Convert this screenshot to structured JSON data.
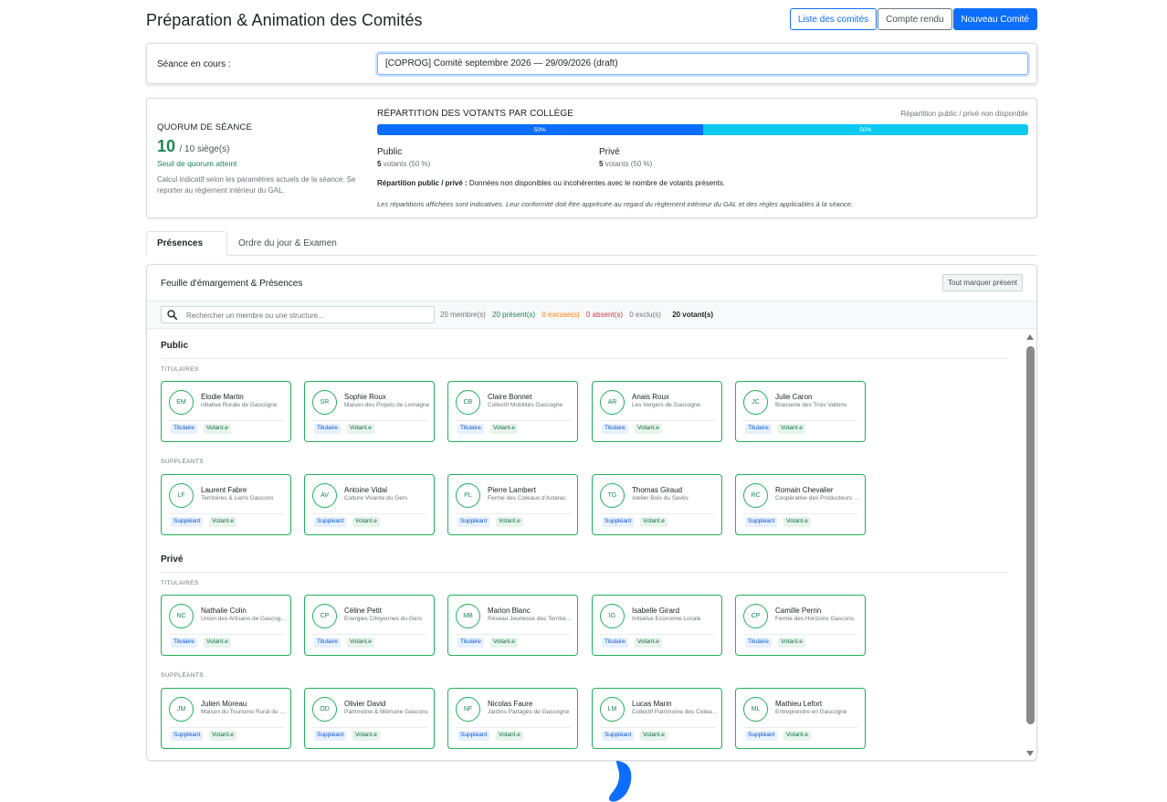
{
  "header": {
    "title": "Préparation & Animation des Comités",
    "btn_list": "Liste des comités",
    "btn_report": "Compte rendu",
    "btn_new": "Nouveau Comité"
  },
  "session": {
    "label": "Séance en cours :",
    "value": "[COPROG] Comité septembre 2026 — 29/09/2026 (draft)"
  },
  "quorum": {
    "title": "QUORUM DE SÉANCE",
    "count": "10",
    "seats": "/ 10 siège(s)",
    "status": "Seuil de quorum atteint",
    "note": "Calcul indicatif selon les paramètres actuels de la séance. Se reporter au règlement intérieur du GAL."
  },
  "split": {
    "title": "RÉPARTITION DES VOTANTS PAR COLLÈGE",
    "unavailable": "Répartition public / privé non disponible",
    "bar": [
      {
        "label": "50%",
        "fraction": 0.5,
        "color": "#0d6efd"
      },
      {
        "label": "50%",
        "fraction": 0.5,
        "color": "#0dcaf0"
      }
    ],
    "public": {
      "name": "Public",
      "votes_num": "5",
      "votes_text": "votants (50 %)"
    },
    "private": {
      "name": "Privé",
      "votes_num": "5",
      "votes_text": "votants (50 %)"
    },
    "split_label": "Répartition public / privé :",
    "split_text": "Données non disponibles ou incohérentes avec le nombre de votants présents.",
    "disclaimer": "Les répartitions affichées sont indicatives. Leur conformité doit être appréciée au regard du règlement intérieur du GAL et des règles applicables à la séance."
  },
  "tabs": [
    {
      "label": "Présences",
      "active": true
    },
    {
      "label": "Ordre du jour & Examen",
      "active": false
    }
  ],
  "attendance": {
    "title": "Feuille d'émargement & Présences",
    "mark_all": "Tout marquer présent",
    "search_placeholder": "Rechercher un membre ou une structure...",
    "stats": {
      "members": "20 membre(s)",
      "present": "20 présent(s)",
      "excused": "0 excuse(s)",
      "absent": "0 absent(s)",
      "excluded": "0 exclu(s)",
      "voting": "20 votant(s)"
    },
    "groups": [
      {
        "name": "Public",
        "sections": [
          {
            "label": "TITULAIRES",
            "role": "Titulaire",
            "members": [
              {
                "initials": "EM",
                "name": "Élodie Martin",
                "org": "nitiative Rurale de Gascogne",
                "vote": "Votant.e"
              },
              {
                "initials": "SR",
                "name": "Sophie Roux",
                "org": "Maison des Projets de Lomagne",
                "vote": "Votant.e"
              },
              {
                "initials": "CB",
                "name": "Claire Bonnet",
                "org": "Collectif Mobilités Gascogne",
                "vote": "Votant.e"
              },
              {
                "initials": "AR",
                "name": "Anais Roux",
                "org": "Les Vergers de Gascogne",
                "vote": "Votant.e"
              },
              {
                "initials": "JC",
                "name": "Julie Caron",
                "org": "Brasserie des Trois Vallons",
                "vote": "Votant.e"
              }
            ]
          },
          {
            "label": "SUPPLÉANTS",
            "role": "Suppléant",
            "members": [
              {
                "initials": "LF",
                "name": "Laurent Fabre",
                "org": "Territoires & Liens Gascons",
                "vote": "Votant.e"
              },
              {
                "initials": "AV",
                "name": "Antoine Vidal",
                "org": "Culture Vivante du Gers",
                "vote": "Votant.e"
              },
              {
                "initials": "PL",
                "name": "Pierre Lambert",
                "org": "Ferme des Coteaux d'Astarac",
                "vote": "Votant.e"
              },
              {
                "initials": "TG",
                "name": "Thomas Giraud",
                "org": "Atelier Bois du Savès",
                "vote": "Votant.e"
              },
              {
                "initials": "RC",
                "name": "Romain Chevalier",
                "org": "Coopérative des Producteurs du Gers",
                "vote": "Votant.e"
              }
            ]
          }
        ]
      },
      {
        "name": "Privé",
        "sections": [
          {
            "label": "TITULAIRES",
            "role": "Titulaire",
            "members": [
              {
                "initials": "NC",
                "name": "Nathalie Colin",
                "org": "Union des Artisans de Gascogne",
                "vote": "Votant.e"
              },
              {
                "initials": "CP",
                "name": "Céline Petit",
                "org": "Energies Citoyennes du Gers",
                "vote": "Votant.e"
              },
              {
                "initials": "MB",
                "name": "Marion Blanc",
                "org": "Réseau Jeunesse des Territoires",
                "vote": "Votant.e"
              },
              {
                "initials": "IG",
                "name": "Isabelle Girard",
                "org": "Initiative Economie Locale",
                "vote": "Votant.e"
              },
              {
                "initials": "CP",
                "name": "Camille Perrin",
                "org": "Ferme des Horizons Gascons",
                "vote": "Votant.e"
              }
            ]
          },
          {
            "label": "SUPPLÉANTS",
            "role": "Suppléant",
            "members": [
              {
                "initials": "JM",
                "name": "Julien Moreau",
                "org": "Maison du Tourisme Rural du Gers",
                "vote": "Votant.e"
              },
              {
                "initials": "OD",
                "name": "Olivier David",
                "org": "Patrimoine & Mémoire Gascons",
                "vote": "Votant.e"
              },
              {
                "initials": "NF",
                "name": "Nicolas Faure",
                "org": "Jardins Partagés de Gascogne",
                "vote": "Votant.e"
              },
              {
                "initials": "LM",
                "name": "Lucas Marin",
                "org": "Collectif Patrimoine des Coteaux",
                "vote": "Votant.e"
              },
              {
                "initials": "ML",
                "name": "Mathieu Lefort",
                "org": "Entreprendre en Gascogne",
                "vote": "Votant.e"
              }
            ]
          }
        ]
      }
    ]
  }
}
